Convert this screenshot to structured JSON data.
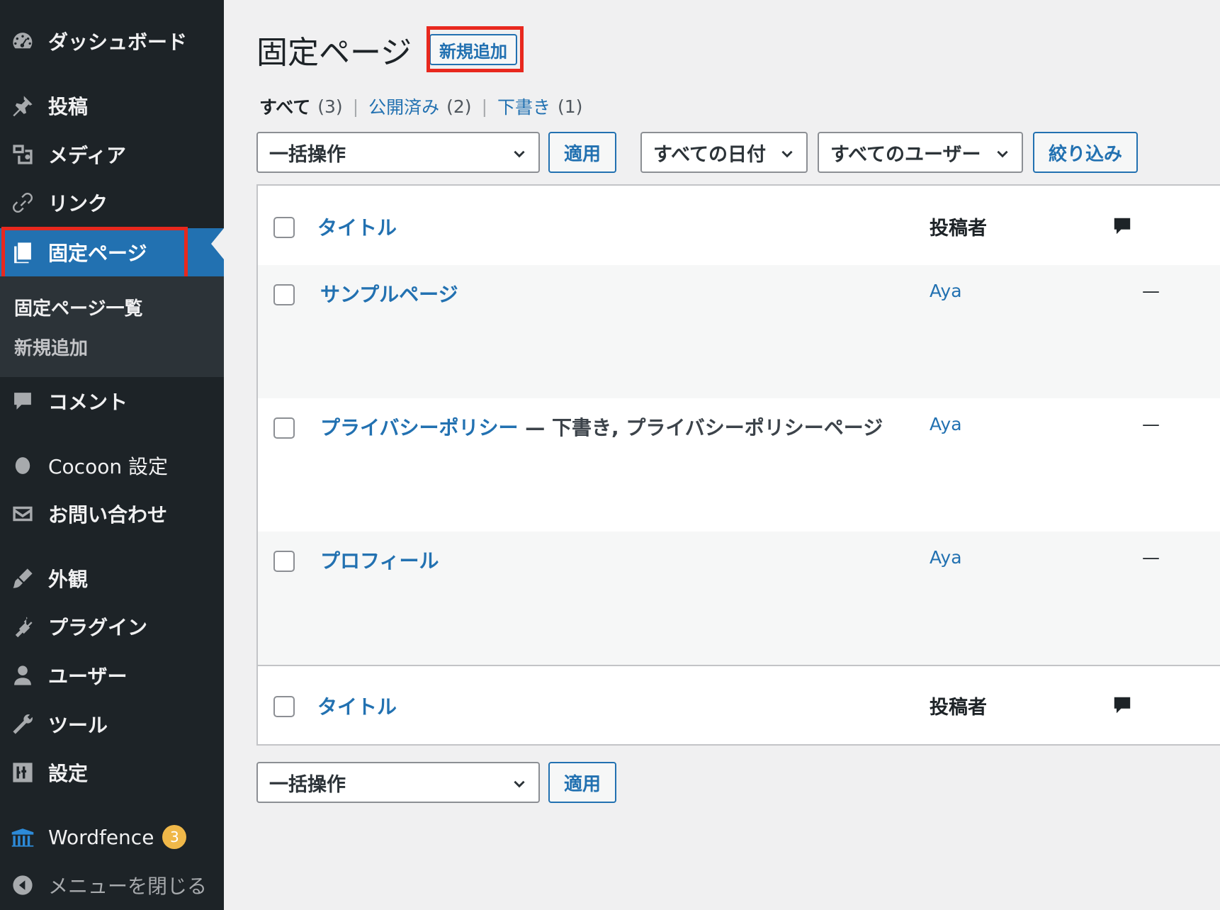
{
  "sidebar": {
    "items": [
      {
        "label": "ダッシュボード",
        "icon": "dashboard-icon"
      },
      {
        "label": "投稿",
        "icon": "pin-icon"
      },
      {
        "label": "メディア",
        "icon": "media-icon"
      },
      {
        "label": "リンク",
        "icon": "link-icon"
      },
      {
        "label": "固定ページ",
        "icon": "page-icon"
      },
      {
        "label": "コメント",
        "icon": "comment-icon"
      },
      {
        "label": "Cocoon 設定",
        "icon": "cocoon-icon"
      },
      {
        "label": "お問い合わせ",
        "icon": "mail-icon"
      },
      {
        "label": "外観",
        "icon": "brush-icon"
      },
      {
        "label": "プラグイン",
        "icon": "plugin-icon"
      },
      {
        "label": "ユーザー",
        "icon": "user-icon"
      },
      {
        "label": "ツール",
        "icon": "wrench-icon"
      },
      {
        "label": "設定",
        "icon": "settings-icon"
      },
      {
        "label": "Wordfence",
        "icon": "wordfence-icon",
        "badge": "3"
      },
      {
        "label": "メニューを閉じる",
        "icon": "collapse-icon"
      }
    ],
    "submenu": [
      {
        "label": "固定ページ一覧"
      },
      {
        "label": "新規追加"
      }
    ]
  },
  "main": {
    "title": "固定ページ",
    "add_new": "新規追加",
    "views": {
      "all": "すべて",
      "all_count": "(3)",
      "publish": "公開済み",
      "publish_count": "(2)",
      "draft": "下書き",
      "draft_count": "(1)",
      "separator": "|"
    },
    "bulk_action": "一括操作",
    "apply": "適用",
    "date_filter": "すべての日付",
    "user_filter": "すべてのユーザー",
    "filter_button": "絞り込み",
    "table": {
      "col_title": "タイトル",
      "col_author": "投稿者",
      "rows": [
        {
          "title": "サンプルページ",
          "state": "",
          "author": "Aya",
          "comments": "—"
        },
        {
          "title": "プライバシーポリシー",
          "state": " — 下書き, プライバシーポリシーページ",
          "author": "Aya",
          "comments": "—"
        },
        {
          "title": "プロフィール",
          "state": "",
          "author": "Aya",
          "comments": "—"
        }
      ]
    }
  },
  "colors": {
    "sidebar_bg": "#1d2327",
    "accent": "#2271b1",
    "highlight": "#e8281e",
    "badge": "#f0b849"
  }
}
